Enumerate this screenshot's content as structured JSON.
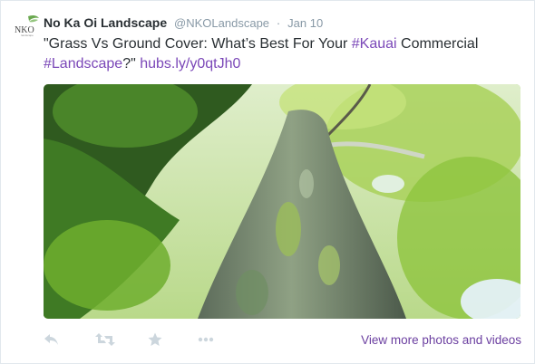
{
  "tweet": {
    "author_name": "No Ka Oi Landscape",
    "handle": "@NKOLandscape",
    "separator": "·",
    "date": "Jan 10",
    "text_part1": "\"Grass Vs Ground Cover: What’s Best For Your ",
    "hashtag1": "#Kauai",
    "text_part2": " Commercial ",
    "hashtag2": "#Landscape",
    "text_part3": "?\" ",
    "link": "hubs.ly/y0qtJh0"
  },
  "avatar": {
    "logo_text": "NKO",
    "logo_subtext": "landscape"
  },
  "media": {
    "description_icon": "photo"
  },
  "actions": {
    "reply_icon": "reply-icon",
    "retweet_icon": "retweet-icon",
    "favorite_icon": "star-icon",
    "more_icon": "ellipsis-icon",
    "view_more_label": "View more photos and videos"
  },
  "colors": {
    "accent": "#7b48b8",
    "name": "#292f33",
    "muted": "#8899a6",
    "action_icons": "#ccd6dd"
  }
}
